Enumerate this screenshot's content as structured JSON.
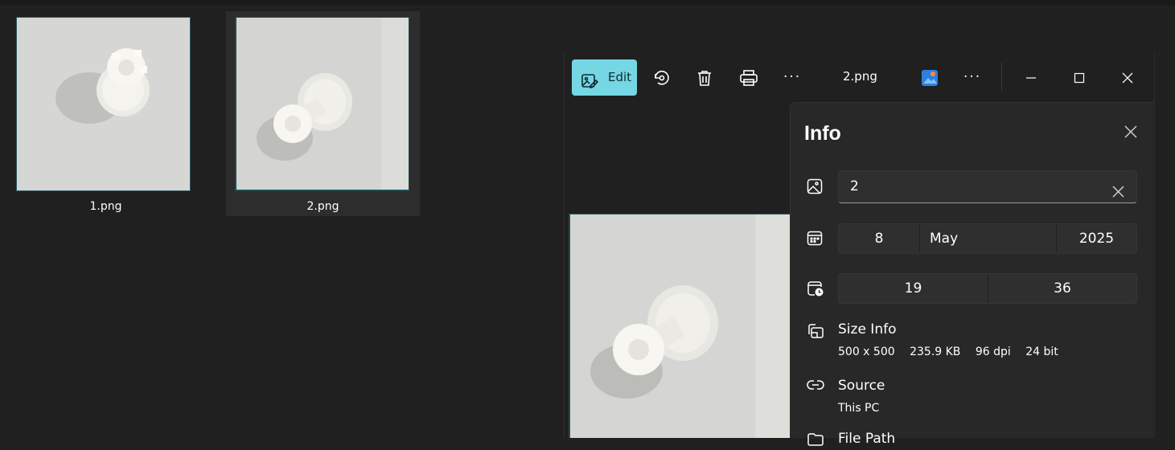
{
  "explorer": {
    "files": [
      {
        "name": "1.png"
      },
      {
        "name": "2.png"
      }
    ]
  },
  "photos": {
    "toolbar": {
      "edit_label": "Edit",
      "title": "2.png",
      "more_glyph": "···"
    },
    "info": {
      "title": "Info",
      "name_value": "2",
      "date": {
        "day": "8",
        "month": "May",
        "year": "2025"
      },
      "time": {
        "hour": "19",
        "minute": "36"
      },
      "size": {
        "title": "Size Info",
        "dimensions": "500 x 500",
        "file_size": "235.9 KB",
        "dpi": "96 dpi",
        "bit_depth": "24 bit"
      },
      "source": {
        "title": "Source",
        "value": "This PC"
      },
      "file_path_title": "File Path"
    }
  },
  "colors": {
    "accent": "#76d7e4",
    "background": "#202020",
    "panel": "#282828"
  }
}
